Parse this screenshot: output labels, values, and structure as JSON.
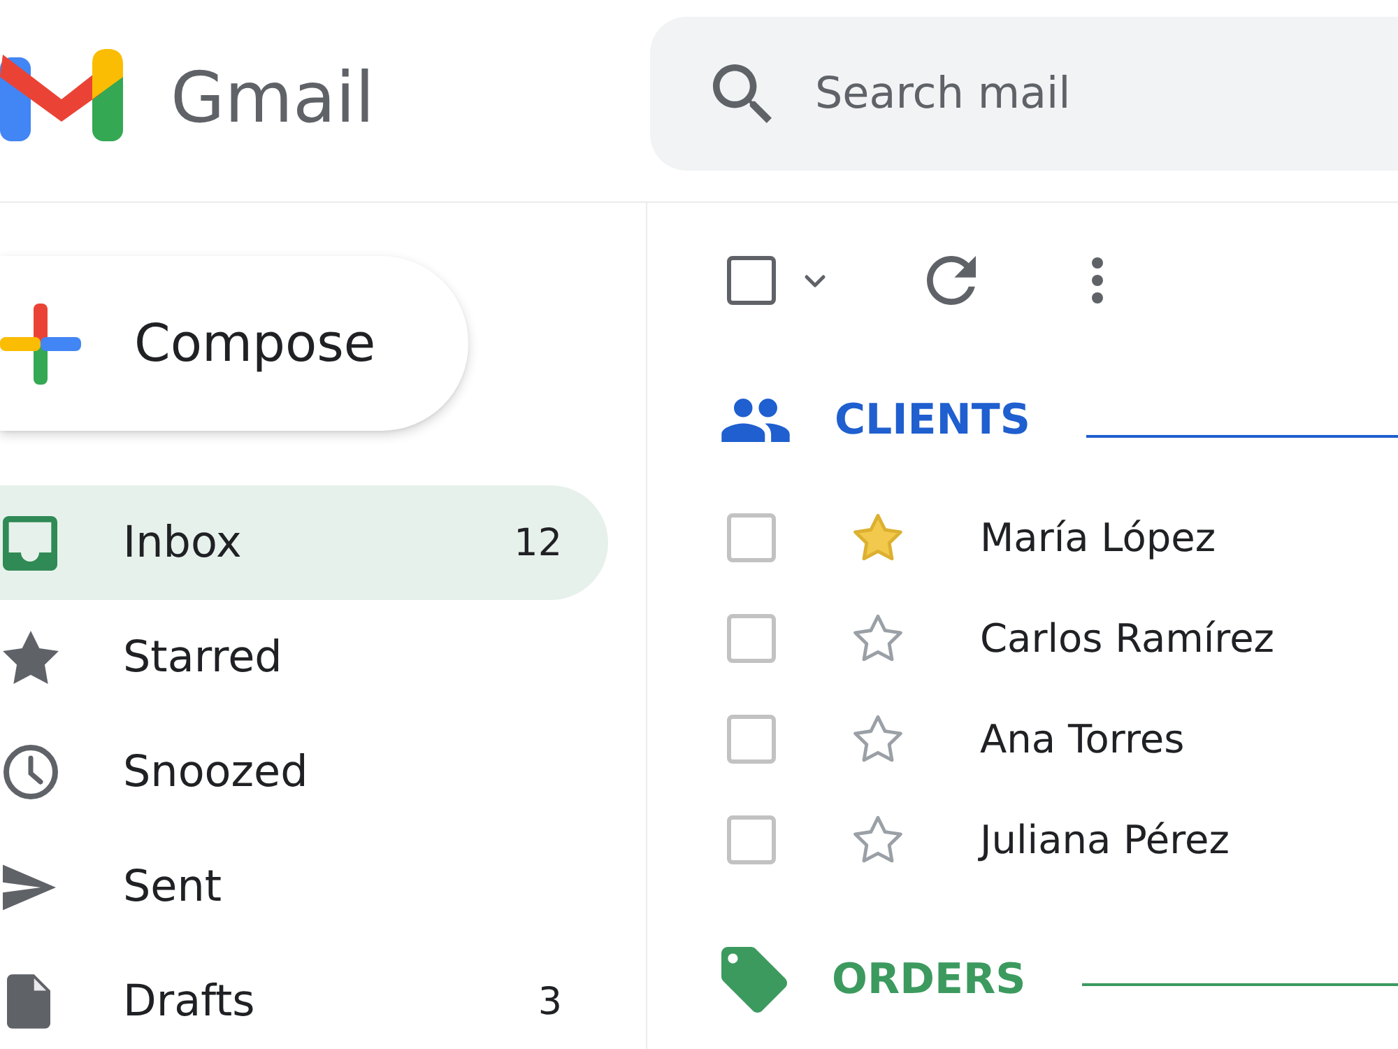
{
  "header": {
    "brand": "Gmail",
    "search": {
      "placeholder": "Search mail"
    }
  },
  "sidebar": {
    "compose": "Compose",
    "items": [
      {
        "label": "Inbox",
        "count": "12",
        "selected": true
      },
      {
        "label": "Starred",
        "selected": false
      },
      {
        "label": "Snoozed",
        "selected": false
      },
      {
        "label": "Sent",
        "selected": false
      },
      {
        "label": "Drafts",
        "count": "3",
        "selected": false
      }
    ]
  },
  "toolbar": {
    "select_all_checked": false
  },
  "sections": [
    {
      "title": "CLIENTS",
      "color": "#1f5fcf",
      "rows": [
        {
          "sender": "María López",
          "checked": false,
          "starred": true
        },
        {
          "sender": "Carlos Ramírez",
          "checked": false,
          "starred": false
        },
        {
          "sender": "Ana Torres",
          "checked": false,
          "starred": false
        },
        {
          "sender": "Juliana Pérez",
          "checked": false,
          "starred": false
        }
      ]
    },
    {
      "title": "ORDERS",
      "color": "#3c9a5f"
    }
  ]
}
